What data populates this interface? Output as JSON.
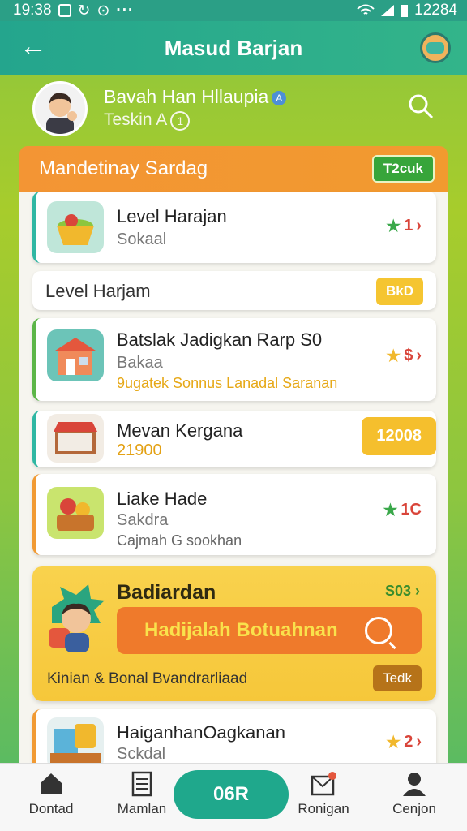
{
  "status_bar": {
    "time": "19:38",
    "clock_right": "12284",
    "dots": "···"
  },
  "app_bar": {
    "title": "Masud Barjan"
  },
  "profile": {
    "name": "Bavah Han Hllaupia",
    "verified_badge": "A",
    "subtitle": "Teskin A",
    "subtitle_badge": "1"
  },
  "card": {
    "header_title": "Mandetinay Sardag",
    "header_chip": "T2cuk"
  },
  "items": [
    {
      "title": "Level Harajan",
      "subtitle": "Sokaal",
      "rating": "1",
      "star": "green"
    },
    {
      "title": "Level Harjam",
      "badge": "BkD"
    },
    {
      "title": "Batslak Jadigkan Rarp S0",
      "subtitle": "Bakaa",
      "note": "9ugatek Sonnus Lanadal Saranan",
      "rating": "$",
      "star": "yellow"
    },
    {
      "title": "Mevan Kergana",
      "value": "21900",
      "badge": "12008"
    },
    {
      "title": "Liake Hade",
      "subtitle": "Sakdra",
      "note": "Cajmah G sookhan",
      "rating": "1C",
      "star": "green"
    },
    {
      "title": "HaiganhanOagkanan",
      "subtitle": "Sckdal",
      "rating": "2",
      "star": "yellow"
    }
  ],
  "promo": {
    "title": "Badiardan",
    "count": "S03",
    "button_label": "Hadijalah Botuahnan",
    "footer_text": "Kinian & Bonal Bvandrarliaad",
    "footer_button": "Tedk"
  },
  "bottom_nav": [
    {
      "label": "Dontad"
    },
    {
      "label": "Mamlan"
    },
    {
      "label": "06R"
    },
    {
      "label": "Ronigan"
    },
    {
      "label": "Cenjon"
    }
  ]
}
